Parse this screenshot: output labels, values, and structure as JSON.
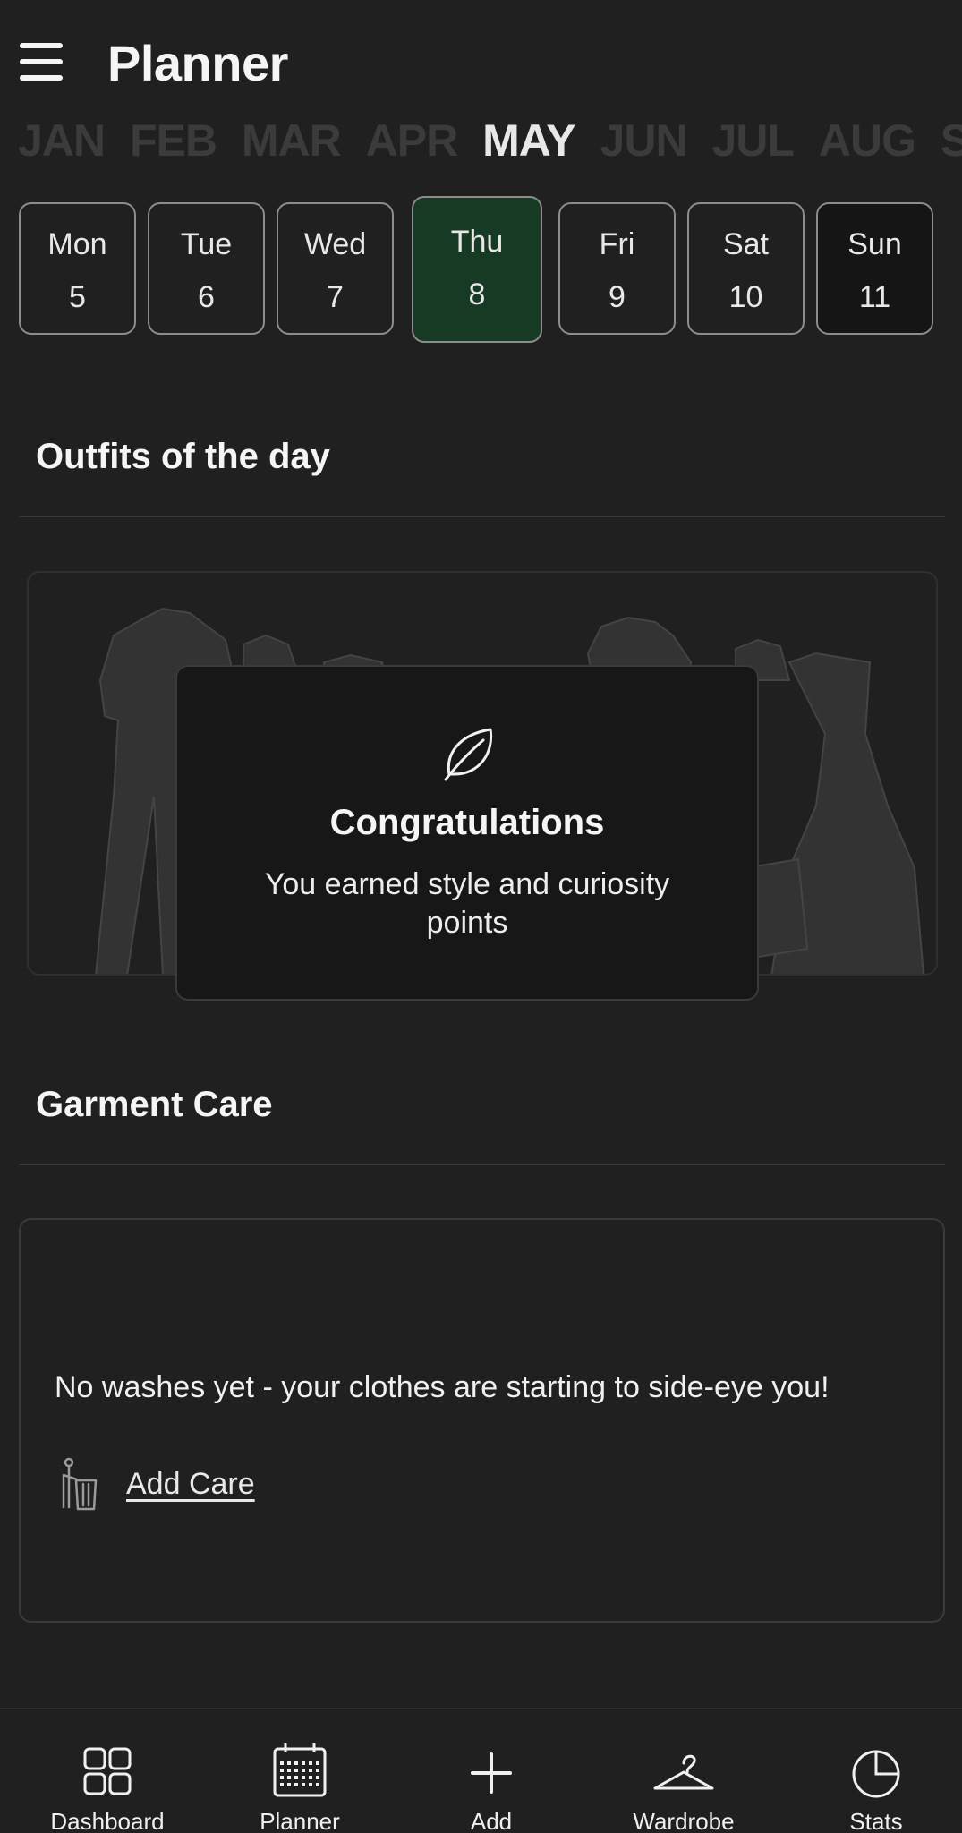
{
  "header": {
    "title": "Planner",
    "menu_icon": "hamburger-menu-icon"
  },
  "months": [
    "JAN",
    "FEB",
    "MAR",
    "APR",
    "MAY",
    "JUN",
    "JUL",
    "AUG",
    "SEP"
  ],
  "selected_month": "MAY",
  "days": [
    {
      "name": "Mon",
      "num": "5"
    },
    {
      "name": "Tue",
      "num": "6"
    },
    {
      "name": "Wed",
      "num": "7"
    },
    {
      "name": "Thu",
      "num": "8"
    },
    {
      "name": "Fri",
      "num": "9"
    },
    {
      "name": "Sat",
      "num": "10"
    },
    {
      "name": "Sun",
      "num": "11"
    }
  ],
  "selected_day": "Thu",
  "outfits": {
    "title": "Outfits of the day",
    "congrats_title": "Congratulations",
    "congrats_text": "You earned style and curiosity points",
    "icon": "leaf-icon"
  },
  "care": {
    "title": "Garment Care",
    "empty_text": "No washes yet - your clothes are starting to side-eye you!",
    "add_label": "Add Care",
    "icon": "washing-person-icon"
  },
  "nav": [
    {
      "label": "Dashboard",
      "icon": "dashboard-grid-icon"
    },
    {
      "label": "Planner",
      "icon": "calendar-icon"
    },
    {
      "label": "Add",
      "icon": "plus-icon"
    },
    {
      "label": "Wardrobe",
      "icon": "hanger-icon"
    },
    {
      "label": "Stats",
      "icon": "pie-chart-icon"
    }
  ],
  "colors": {
    "background": "#202020",
    "selected_day": "#163a24",
    "inactive_month": "#3b3b3b"
  }
}
